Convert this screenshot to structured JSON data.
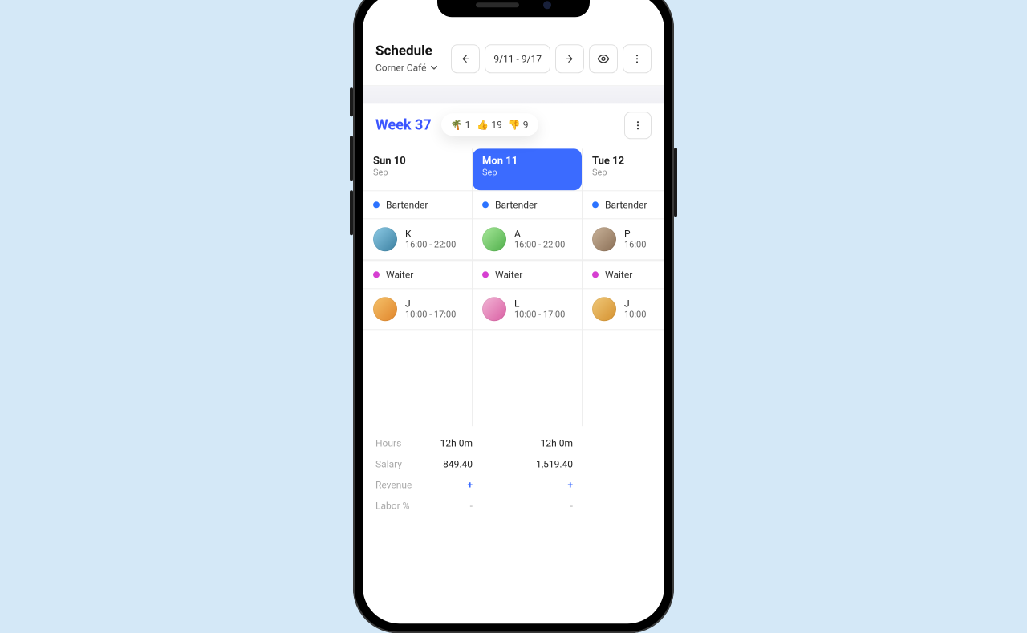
{
  "header": {
    "title": "Schedule",
    "location": "Corner Café",
    "date_range": "9/11 - 9/17"
  },
  "week": {
    "label": "Week 37",
    "pill": {
      "palm": "1",
      "thumbs_up": "19",
      "thumbs_down": "9"
    }
  },
  "days": [
    {
      "name": "Sun 10",
      "month": "Sep",
      "selected": false,
      "roles": [
        {
          "role": "Bartender",
          "color": "blue",
          "shifts": [
            {
              "name": "K",
              "time": "16:00 - 22:00",
              "av": "av1"
            }
          ]
        },
        {
          "role": "Waiter",
          "color": "pink",
          "shifts": [
            {
              "name": "J",
              "time": "10:00 - 17:00",
              "av": "av2"
            }
          ]
        }
      ]
    },
    {
      "name": "Mon 11",
      "month": "Sep",
      "selected": true,
      "roles": [
        {
          "role": "Bartender",
          "color": "blue",
          "shifts": [
            {
              "name": "A",
              "time": "16:00 - 22:00",
              "av": "av3"
            }
          ]
        },
        {
          "role": "Waiter",
          "color": "pink",
          "shifts": [
            {
              "name": "L",
              "time": "10:00 - 17:00",
              "av": "av4"
            }
          ]
        }
      ]
    },
    {
      "name": "Tue 12",
      "month": "Sep",
      "selected": false,
      "roles": [
        {
          "role": "Bartender",
          "color": "blue",
          "shifts": [
            {
              "name": "P",
              "time": "16:00",
              "av": "av5"
            }
          ]
        },
        {
          "role": "Waiter",
          "color": "pink",
          "shifts": [
            {
              "name": "J",
              "time": "10:00",
              "av": "av6"
            }
          ]
        }
      ]
    }
  ],
  "stats": {
    "rows": [
      {
        "label": "Hours",
        "v1": "12h 0m",
        "v2": "12h 0m"
      },
      {
        "label": "Salary",
        "v1": "849.40",
        "v2": "1,519.40"
      },
      {
        "label": "Revenue",
        "v1": "+",
        "v2": "+",
        "kind": "plus"
      },
      {
        "label": "Labor %",
        "v1": "-",
        "v2": "-",
        "kind": "dash"
      }
    ]
  },
  "icons": {
    "palm": "🌴",
    "up": "👍",
    "down": "👎"
  }
}
